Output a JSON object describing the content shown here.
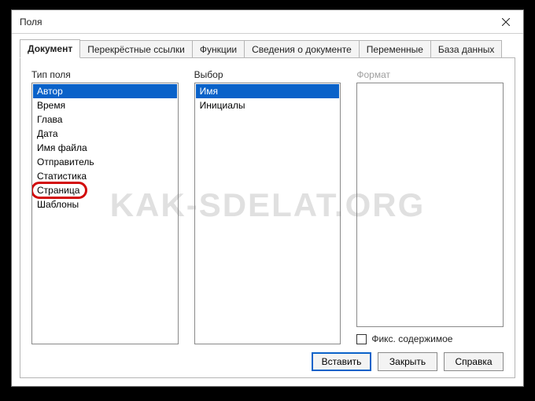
{
  "window": {
    "title": "Поля"
  },
  "tabs": [
    {
      "label": "Документ",
      "active": true
    },
    {
      "label": "Перекрёстные ссылки"
    },
    {
      "label": "Функции"
    },
    {
      "label": "Сведения о документе"
    },
    {
      "label": "Переменные"
    },
    {
      "label": "База данных"
    }
  ],
  "columns": {
    "type": {
      "label": "Тип поля",
      "items": [
        "Автор",
        "Время",
        "Глава",
        "Дата",
        "Имя файла",
        "Отправитель",
        "Статистика",
        "Страница",
        "Шаблоны"
      ],
      "selected": 0,
      "highlighted": 7
    },
    "select": {
      "label": "Выбор",
      "items": [
        "Имя",
        "Инициалы"
      ],
      "selected": 0
    },
    "format": {
      "label": "Формат",
      "disabled": true
    }
  },
  "checkbox": {
    "label": "Фикс. содержимое",
    "checked": false
  },
  "buttons": {
    "insert": "Вставить",
    "close": "Закрыть",
    "help": "Справка"
  },
  "watermark": "KAK-SDELAT.ORG"
}
